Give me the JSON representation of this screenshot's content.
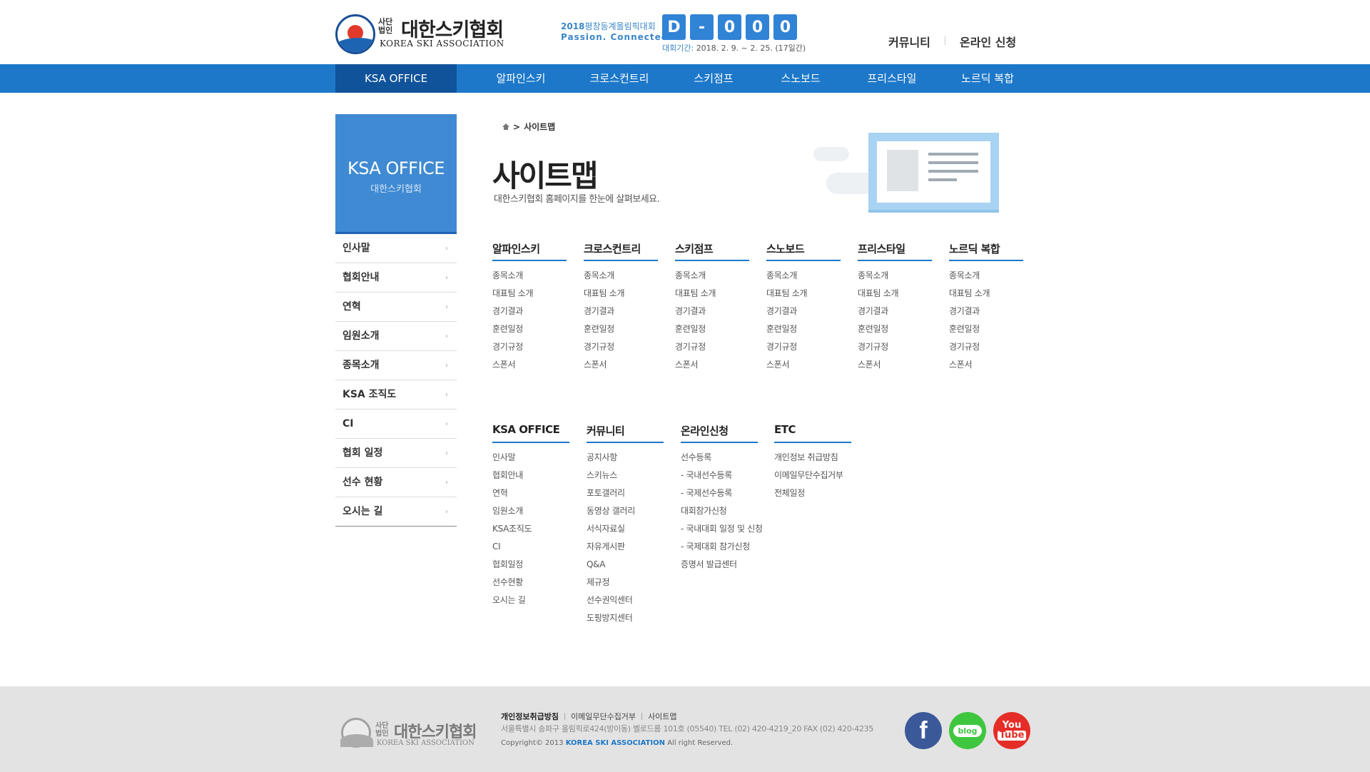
{
  "header": {
    "logo": {
      "small_text": "사단법인",
      "korean_name": "대한스키협회",
      "english_name": "KOREA SKI ASSOCIATION"
    },
    "olympic": {
      "line1_year": "2018",
      "line1_text": "평창동계올림픽대회",
      "line2": "Passion. Connected."
    },
    "dday": [
      "D",
      "-",
      "0",
      "0",
      "0"
    ],
    "period_label": "대회기간:",
    "period_value": "2018. 2. 9. ~ 2. 25. (17일간)",
    "utility": [
      "커뮤니티",
      "온라인 신청"
    ]
  },
  "gnb": {
    "items": [
      "KSA OFFICE",
      "알파인스키",
      "크로스컨트리",
      "스키점프",
      "스노보드",
      "프리스타일",
      "노르딕 복합"
    ]
  },
  "lnb": {
    "title": "KSA OFFICE",
    "subtitle": "대한스키협회",
    "items": [
      "인사말",
      "협회안내",
      "연혁",
      "임원소개",
      "종목소개",
      "KSA 조직도",
      "CI",
      "협회 일정",
      "선수 현황",
      "오시는 길"
    ]
  },
  "content": {
    "breadcrumb": "사이트맵",
    "title": "사이트맵",
    "description": "대한스키협회 홈페이지를 한눈에 살펴보세요."
  },
  "sitemap_top": [
    {
      "title": "알파인스키",
      "links": [
        "종목소개",
        "대표팀 소개",
        "경기결과",
        "훈련일정",
        "경기규정",
        "스폰서"
      ]
    },
    {
      "title": "크로스컨트리",
      "links": [
        "종목소개",
        "대표팀 소개",
        "경기결과",
        "훈련일정",
        "경기규정",
        "스폰서"
      ]
    },
    {
      "title": "스키점프",
      "links": [
        "종목소개",
        "대표팀 소개",
        "경기결과",
        "훈련일정",
        "경기규정",
        "스폰서"
      ]
    },
    {
      "title": "스노보드",
      "links": [
        "종목소개",
        "대표팀 소개",
        "경기결과",
        "훈련일정",
        "경기규정",
        "스폰서"
      ]
    },
    {
      "title": "프리스타일",
      "links": [
        "종목소개",
        "대표팀 소개",
        "경기결과",
        "훈련일정",
        "경기규정",
        "스폰서"
      ]
    },
    {
      "title": "노르딕 복합",
      "links": [
        "종목소개",
        "대표팀 소개",
        "경기결과",
        "훈련일정",
        "경기규정",
        "스폰서"
      ]
    }
  ],
  "sitemap_bottom": [
    {
      "title": "KSA OFFICE",
      "links": [
        "인사말",
        "협회안내",
        "연혁",
        "임원소개",
        "KSA조직도",
        "CI",
        "협회일정",
        "선수현황",
        "오시는 길"
      ]
    },
    {
      "title": "커뮤니티",
      "links": [
        "공지사항",
        "스키뉴스",
        "포토갤러리",
        "동영상 갤러리",
        "서식자료실",
        "자유게시판",
        "Q&A",
        "제규정",
        "선수권익센터",
        "도핑방지센터"
      ]
    },
    {
      "title": "온라인신청",
      "links": [
        "선수등록",
        "- 국내선수등록",
        "- 국제선수등록",
        "대회참가신청",
        "- 국내대회 일정 및 신청",
        "- 국제대회 참가신청",
        "증명서 발급센터"
      ]
    },
    {
      "title": "ETC",
      "links": [
        "개인정보 취급방침",
        "이메일무단수집거부",
        "전체일정"
      ]
    }
  ],
  "footer": {
    "logo_small": "사단법인",
    "logo_korean": "대한스키협회",
    "logo_english": "KOREA SKI ASSOCIATION",
    "links": [
      "개인정보취급방침",
      "이메일무단수집거부",
      "사이트맵"
    ],
    "address": "서울특별시 송파구 올림픽로424(방이동) 벨로드롬 101호 (05540) TEL (02) 420-4219_20 FAX (02) 420-4235",
    "copyright_prefix": "Copyright© 2013",
    "copyright_org": "KOREA SKI ASSOCIATION",
    "copyright_suffix": "All right Reserved.",
    "sns": {
      "facebook": "f",
      "blog": "blog",
      "youtube_line1": "You",
      "youtube_line2": "Tube"
    }
  },
  "colors": {
    "gnb": "#1d78c9",
    "gnb_active": "#10539a",
    "lnb_header": "#3f8ad2",
    "facebook": "#3b5998",
    "blog": "#3fc63f",
    "youtube": "#e52d27"
  }
}
